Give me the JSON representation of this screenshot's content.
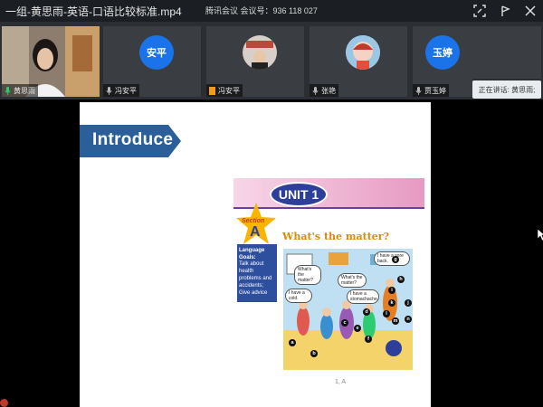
{
  "window": {
    "title": "一组-黄思雨-英语-口语比较标准.mp4",
    "meeting_info": "腾讯会议 会议号：936 118 027"
  },
  "participants": [
    {
      "name": "黄思雨",
      "avatar_text": "",
      "avatar_color": "",
      "mic_color": "#2ecc71"
    },
    {
      "name": "冯安平",
      "avatar_text": "安平",
      "avatar_color": "#1a73e8",
      "mic_color": "#bbbbbb"
    },
    {
      "name": "冯安平",
      "avatar_text": "",
      "avatar_color": "#b84a3c",
      "mic_color": "#f39c12"
    },
    {
      "name": "张艳",
      "avatar_text": "",
      "avatar_color": "#7fb3d5",
      "mic_color": "#bbbbbb"
    },
    {
      "name": "贾玉婷",
      "avatar_text": "玉婷",
      "avatar_color": "#1a73e8",
      "mic_color": "#bbbbbb"
    }
  ],
  "speaking_label": "正在讲话: 黄思雨;",
  "slide": {
    "banner": "Introduce",
    "unit_label": "UNIT 1",
    "section_word": "Section",
    "section_letter": "A",
    "heading": "What's the matter?",
    "goals_title": "Language Goals:",
    "goals_text": "Talk about health problems and accidents; Give advice",
    "bubbles": [
      "What's the matter?",
      "I have a cold.",
      "What's the matter?",
      "I have a stomachache.",
      "I have a sore back."
    ],
    "picture_letters": [
      "a",
      "b",
      "c",
      "d",
      "e",
      "f",
      "g",
      "h",
      "i",
      "j",
      "k",
      "l",
      "m",
      "n"
    ],
    "caption": "1, A"
  },
  "colors": {
    "banner_blue": "#2b5f99",
    "unit_blue": "#2d3f9a",
    "heading_orange": "#e08a00",
    "titlebar": "#1b1e22"
  }
}
